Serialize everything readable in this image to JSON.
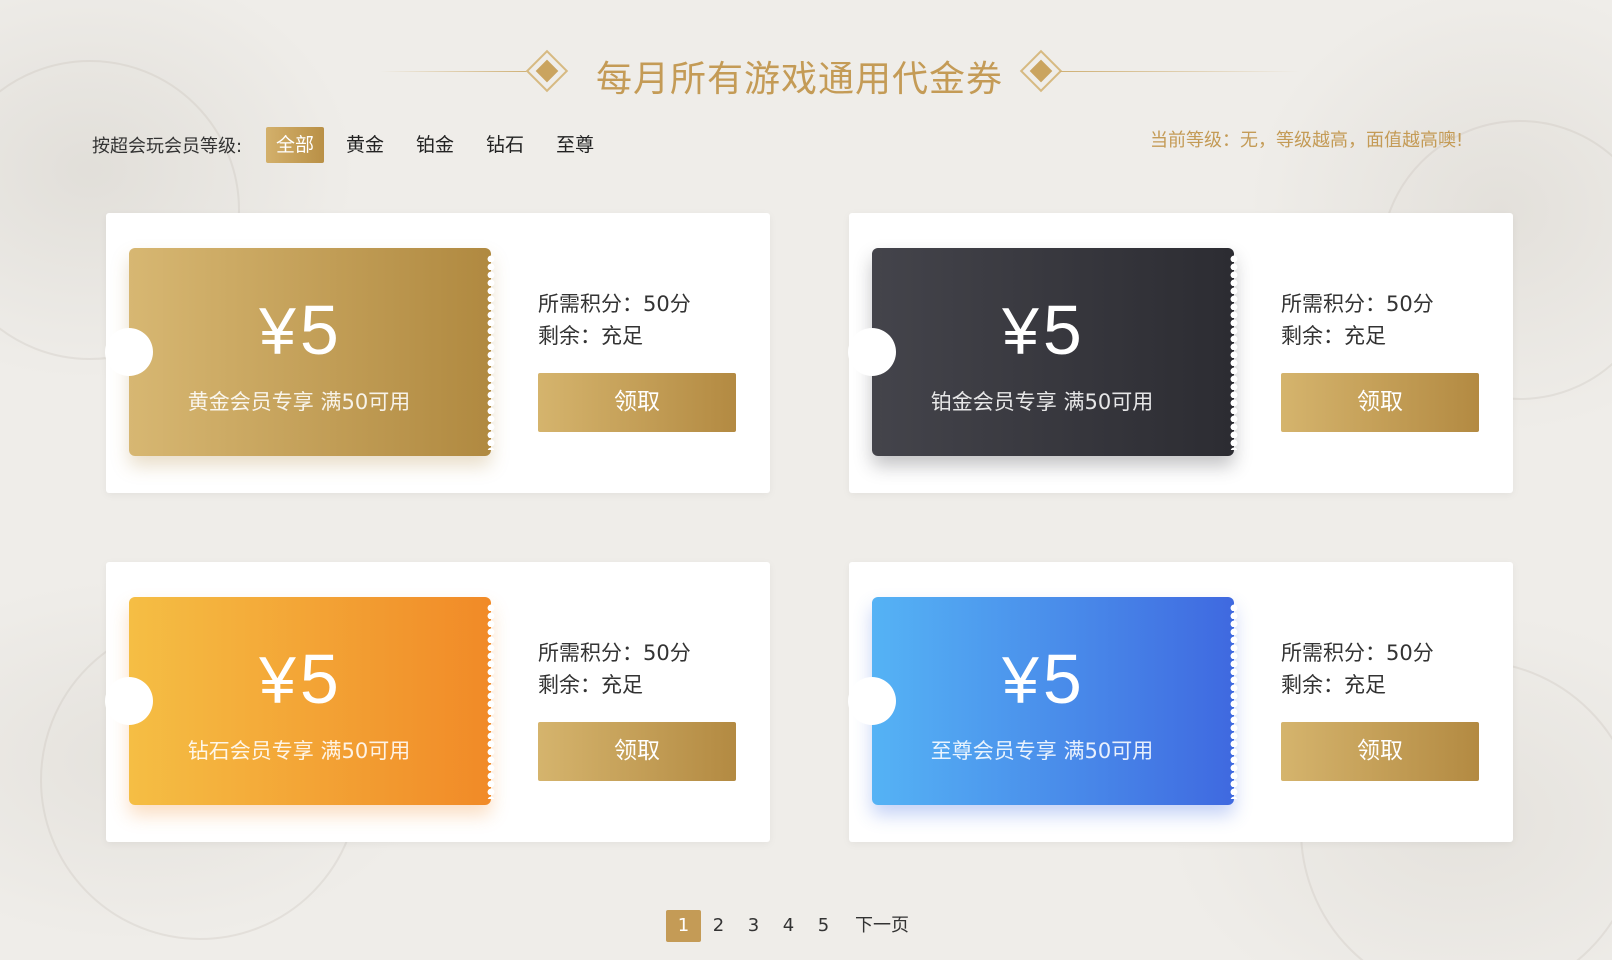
{
  "title": "每月所有游戏通用代金券",
  "filter": {
    "label": "按超会玩会员等级:",
    "tabs": [
      "全部",
      "黄金",
      "铂金",
      "钻石",
      "至尊"
    ],
    "active_index": 0
  },
  "level_tip": "当前等级：无，等级越高，面值越高噢!",
  "coupons": [
    {
      "amount": "5",
      "currency": "¥",
      "desc": "黄金会员专享  满50可用",
      "points": "所需积分：50分",
      "remaining": "剩余：充足",
      "button": "领取",
      "color": "#c9a25a"
    },
    {
      "amount": "5",
      "currency": "¥",
      "desc": "铂金会员专享  满50可用",
      "points": "所需积分：50分",
      "remaining": "剩余：充足",
      "button": "领取",
      "color": "#38383e"
    },
    {
      "amount": "5",
      "currency": "¥",
      "desc": "钻石会员专享  满50可用",
      "points": "所需积分：50分",
      "remaining": "剩余：充足",
      "button": "领取",
      "color": "#f4a535"
    },
    {
      "amount": "5",
      "currency": "¥",
      "desc": "至尊会员专享  满50可用",
      "points": "所需积分：50分",
      "remaining": "剩余：充足",
      "button": "领取",
      "color": "#4a8deb"
    }
  ],
  "pagination": {
    "pages": [
      "1",
      "2",
      "3",
      "4",
      "5"
    ],
    "current": "1",
    "next": "下一页"
  }
}
